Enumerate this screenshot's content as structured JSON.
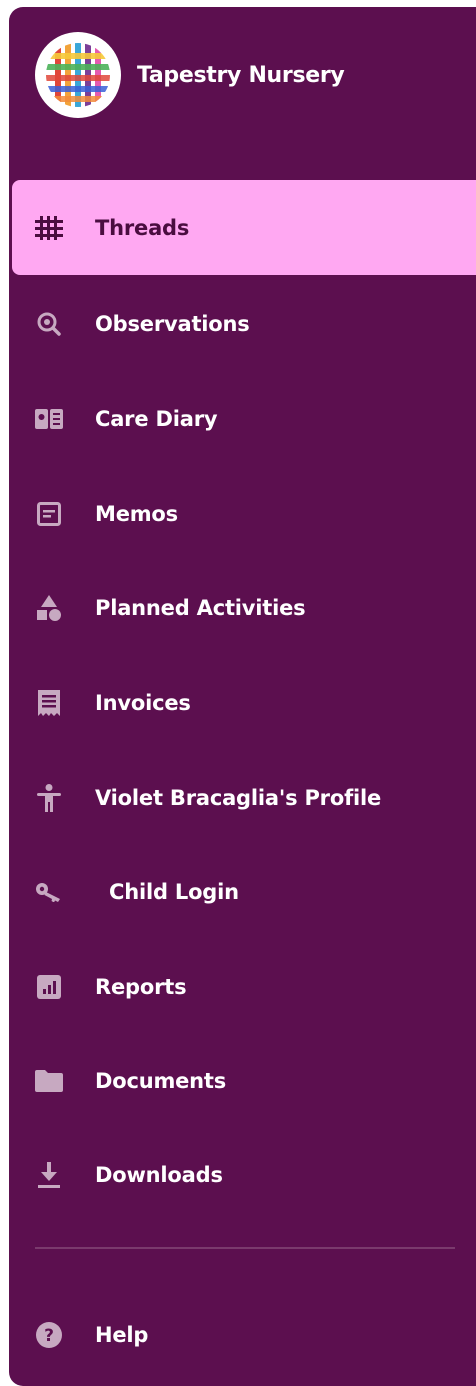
{
  "brand": {
    "name": "Tapestry Nursery",
    "logo_icon": "woven-tapestry-logo"
  },
  "nav": {
    "items": [
      {
        "label": "Threads",
        "icon": "hash-grid-icon",
        "active": true
      },
      {
        "label": "Observations",
        "icon": "magnify-eye-icon",
        "active": false
      },
      {
        "label": "Care Diary",
        "icon": "open-book-icon",
        "active": false
      },
      {
        "label": "Memos",
        "icon": "memo-icon",
        "active": false
      },
      {
        "label": "Planned Activities",
        "icon": "shapes-icon",
        "active": false
      },
      {
        "label": "Invoices",
        "icon": "receipt-icon",
        "active": false
      },
      {
        "label": "Violet Bracaglia's Profile",
        "icon": "child-figure-icon",
        "active": false
      },
      {
        "label": "Child Login",
        "icon": "key-icon",
        "active": false
      },
      {
        "label": "Reports",
        "icon": "bar-chart-icon",
        "active": false
      },
      {
        "label": "Documents",
        "icon": "folder-icon",
        "active": false
      },
      {
        "label": "Downloads",
        "icon": "download-icon",
        "active": false
      }
    ],
    "help": {
      "label": "Help",
      "icon": "question-circle-icon"
    }
  },
  "colors": {
    "sidebar_bg": "#5c0f4f",
    "active_bg": "#ffa8f2",
    "active_text": "#4a0d40",
    "icon_muted": "#c7a9c1",
    "text": "#ffffff"
  }
}
